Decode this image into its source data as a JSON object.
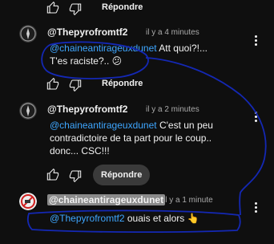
{
  "top_actions": {
    "reply_label": "Répondre"
  },
  "comments": [
    {
      "username": "@Thepyrofromtf2",
      "timestamp": "il y a 4 minutes",
      "mention": "@chaineantirageuxdunet",
      "text_line1_rest": " Att quoi?!...",
      "text_line2": "T'es raciste?..",
      "emoji": "😕",
      "reply_label": "Répondre"
    },
    {
      "username": "@Thepyrofromtf2",
      "timestamp": "il y a 2 minutes",
      "mention": "@chaineantirageuxdunet",
      "text_line1_rest": " C'est un peu",
      "text_line2": "contradictoire de ta part pour le coup..",
      "text_line3": "donc... CSC!!!",
      "reply_label": "Répondre"
    },
    {
      "username": "@chaineantirageuxdunet",
      "timestamp": "il y a 1 minute",
      "mention": "@Thepyrofromtf2",
      "text_line1_rest": " ouais et alors",
      "emoji": "👆"
    }
  ]
}
